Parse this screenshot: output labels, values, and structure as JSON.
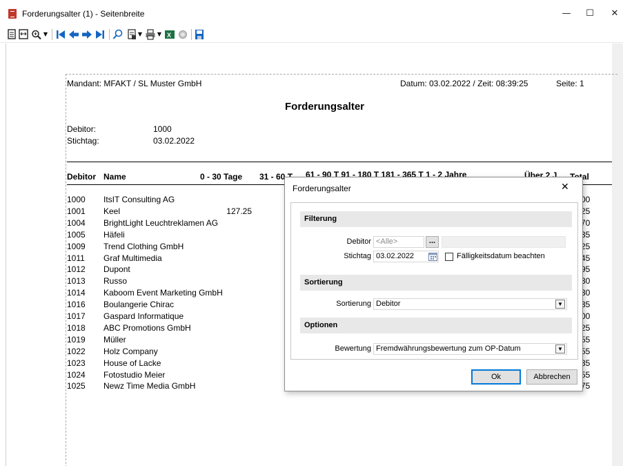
{
  "window": {
    "title": "Forderungsalter (1) - Seitenbreite",
    "minimize_glyph": "—",
    "maximize_glyph": "☐",
    "close_glyph": "✕"
  },
  "toolbar": {
    "icons": [
      "page-single-icon",
      "page-width-icon",
      "zoom-icon",
      "dropdown-arrow-icon",
      "first-page-icon",
      "previous-page-icon",
      "next-page-icon",
      "last-page-icon",
      "search-icon",
      "export-icon",
      "dropdown-arrow-icon",
      "print-icon",
      "dropdown-arrow-icon",
      "excel-icon",
      "stop-icon",
      "save-icon"
    ]
  },
  "report": {
    "mandant": "Mandant: MFAKT / SL Muster GmbH",
    "datum": "Datum: 03.02.2022 / Zeit: 08:39:25",
    "seite": "Seite:  1",
    "title": "Forderungsalter",
    "debitor_label": "Debitor:",
    "debitor_value": "1000",
    "stichtag_label": "Stichtag:",
    "stichtag_value": "03.02.2022",
    "columns": {
      "debitor": "Debitor",
      "name": "Name",
      "c0_30": "0 - 30 Tage",
      "c31_60": "31 - 60 T",
      "partial": "61 - 90 T  91 - 180 T  181 - 365 T  1 - 2 Jahre",
      "ueber": "Über 2 J",
      "total": "Total"
    },
    "rows": [
      {
        "id": "1000",
        "name": "ItsIT Consulting AG",
        "value": "",
        "tail": "00"
      },
      {
        "id": "1001",
        "name": "Keel",
        "value": "127.25",
        "tail": "25"
      },
      {
        "id": "1004",
        "name": "BrightLight Leuchtreklamen AG",
        "value": "",
        "tail": "70"
      },
      {
        "id": "1005",
        "name": "Häfeli",
        "value": "",
        "tail": "35"
      },
      {
        "id": "1009",
        "name": "Trend Clothing GmbH",
        "value": "",
        "tail": "25"
      },
      {
        "id": "1011",
        "name": "Graf Multimedia",
        "value": "",
        "tail": "45"
      },
      {
        "id": "1012",
        "name": "Dupont",
        "value": "",
        "tail": "95"
      },
      {
        "id": "1013",
        "name": "Russo",
        "value": "",
        "tail": "30"
      },
      {
        "id": "1014",
        "name": "Kaboom Event Marketing GmbH",
        "value": "",
        "tail": "30"
      },
      {
        "id": "1016",
        "name": "Boulangerie Chirac",
        "value": "",
        "tail": "35"
      },
      {
        "id": "1017",
        "name": "Gaspard Informatique",
        "value": "",
        "tail": "00"
      },
      {
        "id": "1018",
        "name": "ABC Promotions GmbH",
        "value": "",
        "tail": "25"
      },
      {
        "id": "1019",
        "name": "Müller",
        "value": "",
        "tail": "55"
      },
      {
        "id": "1022",
        "name": "Holz Company",
        "value": "",
        "tail": "55"
      },
      {
        "id": "1023",
        "name": "House of Lacke",
        "value": "",
        "tail": "35"
      },
      {
        "id": "1024",
        "name": "Fotostudio Meier",
        "value": "",
        "tail": "55"
      },
      {
        "id": "1025",
        "name": "Newz Time Media GmbH",
        "value": "",
        "tail": "75"
      }
    ]
  },
  "dialog": {
    "title": "Forderungsalter",
    "close_glyph": "✕",
    "filterung": {
      "header": "Filterung",
      "debitor_label": "Debitor",
      "debitor_placeholder": "<Alle>",
      "browse_label": "...",
      "stichtag_label": "Stichtag",
      "stichtag_value": "03.02.2022",
      "faelligkeit_label": "Fälligkeitsdatum beachten",
      "faelligkeit_checked": false
    },
    "sortierung": {
      "header": "Sortierung",
      "label": "Sortierung",
      "value": "Debitor"
    },
    "optionen": {
      "header": "Optionen",
      "bewertung_label": "Bewertung",
      "bewertung_value": "Fremdwährungsbewertung zum OP-Datum"
    },
    "ok_label": "Ok",
    "cancel_label": "Abbrechen"
  },
  "colors": {
    "accent": "#0078d7",
    "section_bg": "#e8e8e8",
    "excel_green": "#1e7145",
    "nav_blue": "#1565c0"
  }
}
